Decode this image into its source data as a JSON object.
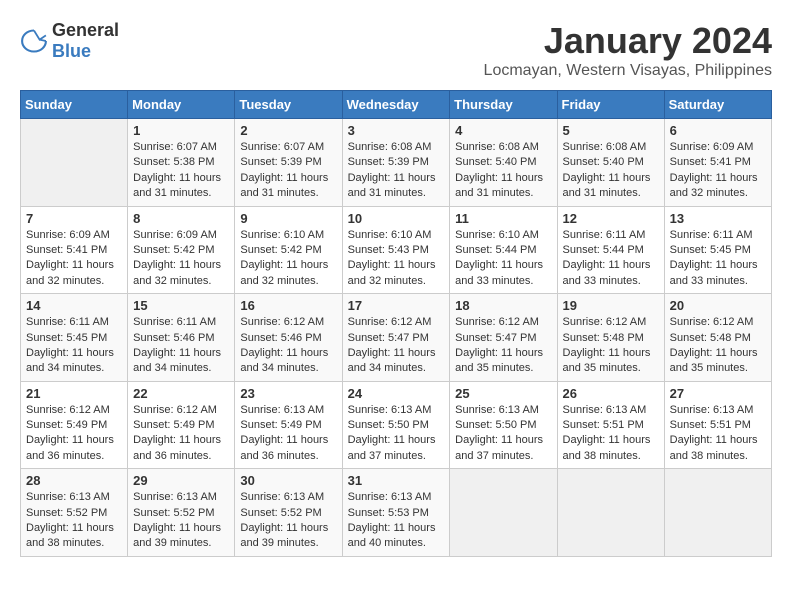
{
  "logo": {
    "general": "General",
    "blue": "Blue"
  },
  "title": "January 2024",
  "location": "Locmayan, Western Visayas, Philippines",
  "days_header": [
    "Sunday",
    "Monday",
    "Tuesday",
    "Wednesday",
    "Thursday",
    "Friday",
    "Saturday"
  ],
  "weeks": [
    [
      {
        "num": "",
        "text": ""
      },
      {
        "num": "1",
        "text": "Sunrise: 6:07 AM\nSunset: 5:38 PM\nDaylight: 11 hours and 31 minutes."
      },
      {
        "num": "2",
        "text": "Sunrise: 6:07 AM\nSunset: 5:39 PM\nDaylight: 11 hours and 31 minutes."
      },
      {
        "num": "3",
        "text": "Sunrise: 6:08 AM\nSunset: 5:39 PM\nDaylight: 11 hours and 31 minutes."
      },
      {
        "num": "4",
        "text": "Sunrise: 6:08 AM\nSunset: 5:40 PM\nDaylight: 11 hours and 31 minutes."
      },
      {
        "num": "5",
        "text": "Sunrise: 6:08 AM\nSunset: 5:40 PM\nDaylight: 11 hours and 31 minutes."
      },
      {
        "num": "6",
        "text": "Sunrise: 6:09 AM\nSunset: 5:41 PM\nDaylight: 11 hours and 32 minutes."
      }
    ],
    [
      {
        "num": "7",
        "text": "Sunrise: 6:09 AM\nSunset: 5:41 PM\nDaylight: 11 hours and 32 minutes."
      },
      {
        "num": "8",
        "text": "Sunrise: 6:09 AM\nSunset: 5:42 PM\nDaylight: 11 hours and 32 minutes."
      },
      {
        "num": "9",
        "text": "Sunrise: 6:10 AM\nSunset: 5:42 PM\nDaylight: 11 hours and 32 minutes."
      },
      {
        "num": "10",
        "text": "Sunrise: 6:10 AM\nSunset: 5:43 PM\nDaylight: 11 hours and 32 minutes."
      },
      {
        "num": "11",
        "text": "Sunrise: 6:10 AM\nSunset: 5:44 PM\nDaylight: 11 hours and 33 minutes."
      },
      {
        "num": "12",
        "text": "Sunrise: 6:11 AM\nSunset: 5:44 PM\nDaylight: 11 hours and 33 minutes."
      },
      {
        "num": "13",
        "text": "Sunrise: 6:11 AM\nSunset: 5:45 PM\nDaylight: 11 hours and 33 minutes."
      }
    ],
    [
      {
        "num": "14",
        "text": "Sunrise: 6:11 AM\nSunset: 5:45 PM\nDaylight: 11 hours and 34 minutes."
      },
      {
        "num": "15",
        "text": "Sunrise: 6:11 AM\nSunset: 5:46 PM\nDaylight: 11 hours and 34 minutes."
      },
      {
        "num": "16",
        "text": "Sunrise: 6:12 AM\nSunset: 5:46 PM\nDaylight: 11 hours and 34 minutes."
      },
      {
        "num": "17",
        "text": "Sunrise: 6:12 AM\nSunset: 5:47 PM\nDaylight: 11 hours and 34 minutes."
      },
      {
        "num": "18",
        "text": "Sunrise: 6:12 AM\nSunset: 5:47 PM\nDaylight: 11 hours and 35 minutes."
      },
      {
        "num": "19",
        "text": "Sunrise: 6:12 AM\nSunset: 5:48 PM\nDaylight: 11 hours and 35 minutes."
      },
      {
        "num": "20",
        "text": "Sunrise: 6:12 AM\nSunset: 5:48 PM\nDaylight: 11 hours and 35 minutes."
      }
    ],
    [
      {
        "num": "21",
        "text": "Sunrise: 6:12 AM\nSunset: 5:49 PM\nDaylight: 11 hours and 36 minutes."
      },
      {
        "num": "22",
        "text": "Sunrise: 6:12 AM\nSunset: 5:49 PM\nDaylight: 11 hours and 36 minutes."
      },
      {
        "num": "23",
        "text": "Sunrise: 6:13 AM\nSunset: 5:49 PM\nDaylight: 11 hours and 36 minutes."
      },
      {
        "num": "24",
        "text": "Sunrise: 6:13 AM\nSunset: 5:50 PM\nDaylight: 11 hours and 37 minutes."
      },
      {
        "num": "25",
        "text": "Sunrise: 6:13 AM\nSunset: 5:50 PM\nDaylight: 11 hours and 37 minutes."
      },
      {
        "num": "26",
        "text": "Sunrise: 6:13 AM\nSunset: 5:51 PM\nDaylight: 11 hours and 38 minutes."
      },
      {
        "num": "27",
        "text": "Sunrise: 6:13 AM\nSunset: 5:51 PM\nDaylight: 11 hours and 38 minutes."
      }
    ],
    [
      {
        "num": "28",
        "text": "Sunrise: 6:13 AM\nSunset: 5:52 PM\nDaylight: 11 hours and 38 minutes."
      },
      {
        "num": "29",
        "text": "Sunrise: 6:13 AM\nSunset: 5:52 PM\nDaylight: 11 hours and 39 minutes."
      },
      {
        "num": "30",
        "text": "Sunrise: 6:13 AM\nSunset: 5:52 PM\nDaylight: 11 hours and 39 minutes."
      },
      {
        "num": "31",
        "text": "Sunrise: 6:13 AM\nSunset: 5:53 PM\nDaylight: 11 hours and 40 minutes."
      },
      {
        "num": "",
        "text": ""
      },
      {
        "num": "",
        "text": ""
      },
      {
        "num": "",
        "text": ""
      }
    ]
  ]
}
